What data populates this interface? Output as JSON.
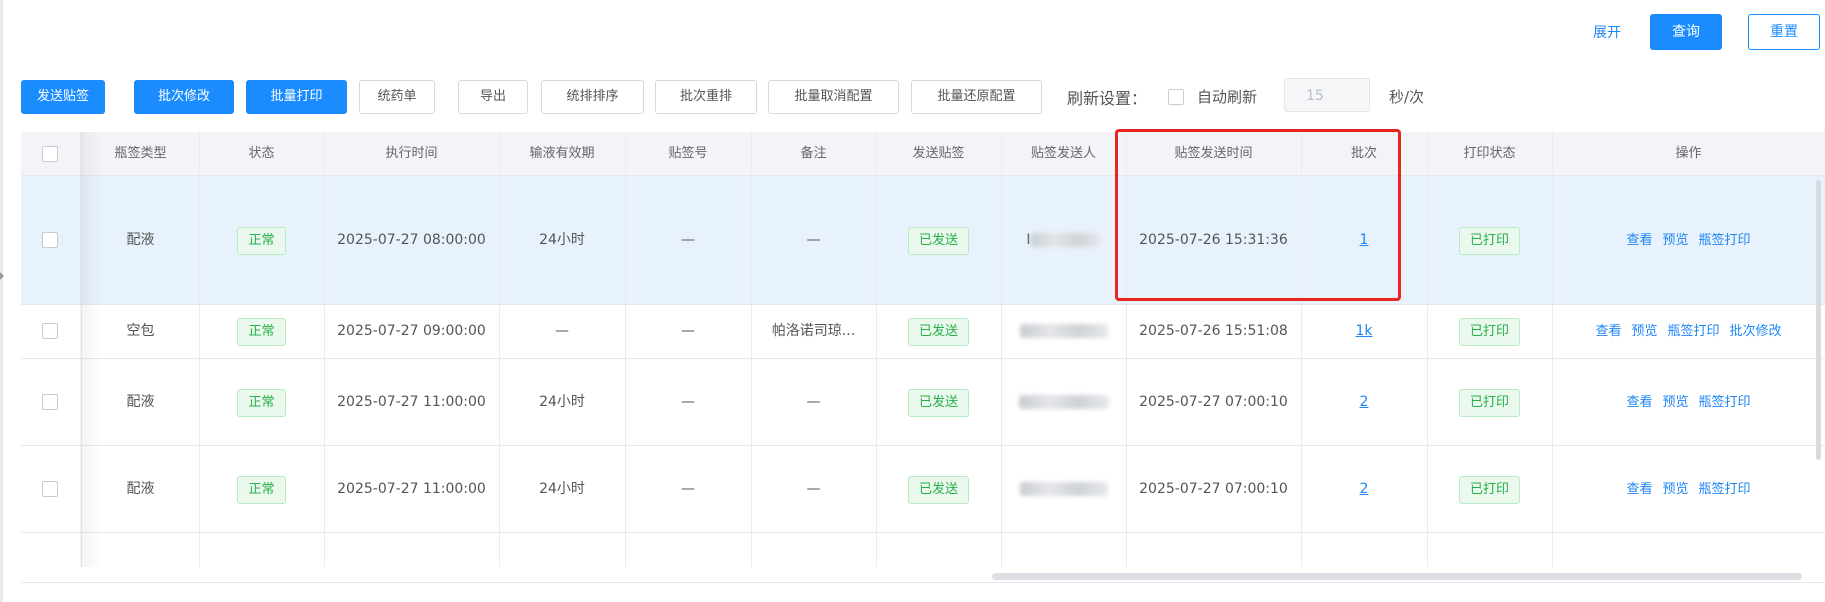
{
  "header": {
    "expand_label": "展开",
    "query_label": "查询",
    "reset_label": "重置"
  },
  "toolbar": {
    "buttons": [
      "发送贴签",
      "批次修改",
      "批量打印",
      "统药单",
      "导出",
      "统排排序",
      "批次重排",
      "批量取消配置",
      "批量还原配置"
    ],
    "refresh_label": "刷新设置：",
    "auto_refresh_label": "自动刷新",
    "interval_value": "15",
    "interval_unit": "秒/次"
  },
  "table": {
    "columns": [
      "瓶签类型",
      "状态",
      "执行时间",
      "输液有效期",
      "贴签号",
      "备注",
      "发送贴签",
      "贴签发送人",
      "贴签发送时间",
      "批次",
      "打印状态",
      "操作"
    ],
    "rows": [
      {
        "type": "配液",
        "status": "正常",
        "exec_time": "2025-07-27 08:00:00",
        "validity": "24小时",
        "label_no": "—",
        "remark": "—",
        "sent": "已发送",
        "sender_prefix": "I",
        "send_time": "2025-07-26 15:31:36",
        "batch": "1",
        "print_status": "已打印",
        "actions": [
          "查看",
          "预览",
          "瓶签打印"
        ]
      },
      {
        "type": "空包",
        "status": "正常",
        "exec_time": "2025-07-27 09:00:00",
        "validity": "—",
        "label_no": "—",
        "remark": "帕洛诺司琼...",
        "sent": "已发送",
        "sender_prefix": "",
        "send_time": "2025-07-26 15:51:08",
        "batch": "1k",
        "print_status": "已打印",
        "actions": [
          "查看",
          "预览",
          "瓶签打印",
          "批次修改"
        ]
      },
      {
        "type": "配液",
        "status": "正常",
        "exec_time": "2025-07-27 11:00:00",
        "validity": "24小时",
        "label_no": "—",
        "remark": "—",
        "sent": "已发送",
        "sender_prefix": "",
        "send_time": "2025-07-27 07:00:10",
        "batch": "2",
        "print_status": "已打印",
        "actions": [
          "查看",
          "预览",
          "瓶签打印"
        ]
      },
      {
        "type": "配液",
        "status": "正常",
        "exec_time": "2025-07-27 11:00:00",
        "validity": "24小时",
        "label_no": "—",
        "remark": "—",
        "sent": "已发送",
        "sender_prefix": "",
        "send_time": "2025-07-27 07:00:10",
        "batch": "2",
        "print_status": "已打印",
        "actions": [
          "查看",
          "预览",
          "瓶签打印"
        ]
      }
    ]
  },
  "colors": {
    "primary": "#1a8cff",
    "success": "#26b048",
    "highlight": "#e8251f",
    "selected_row": "#e8f2fd"
  }
}
